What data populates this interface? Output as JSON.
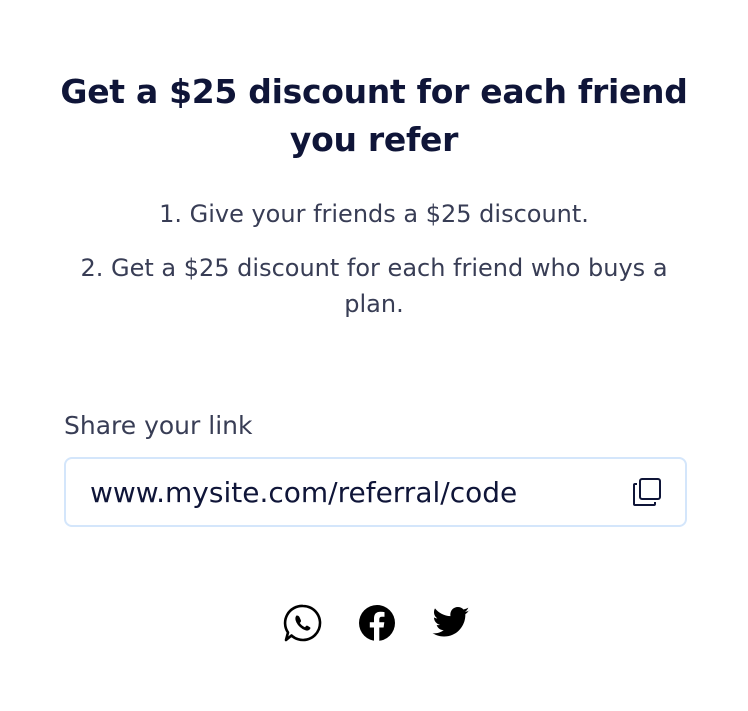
{
  "header": {
    "title": "Get a $25 discount for each friend you refer"
  },
  "steps": [
    {
      "text": "1. Give your friends a $25 discount."
    },
    {
      "text": "2. Get a $25 discount for each friend who buys a plan."
    }
  ],
  "share": {
    "label": "Share your link",
    "link_value": "www.mysite.com/referral/code",
    "copy_icon": "copy-icon"
  },
  "social": [
    {
      "name": "whatsapp",
      "icon": "whatsapp-icon"
    },
    {
      "name": "facebook",
      "icon": "facebook-icon"
    },
    {
      "name": "twitter",
      "icon": "twitter-icon"
    }
  ],
  "colors": {
    "text_primary": "#0f1538",
    "text_secondary": "#383d55",
    "field_border": "#d4e6fb",
    "background": "#ffffff"
  }
}
